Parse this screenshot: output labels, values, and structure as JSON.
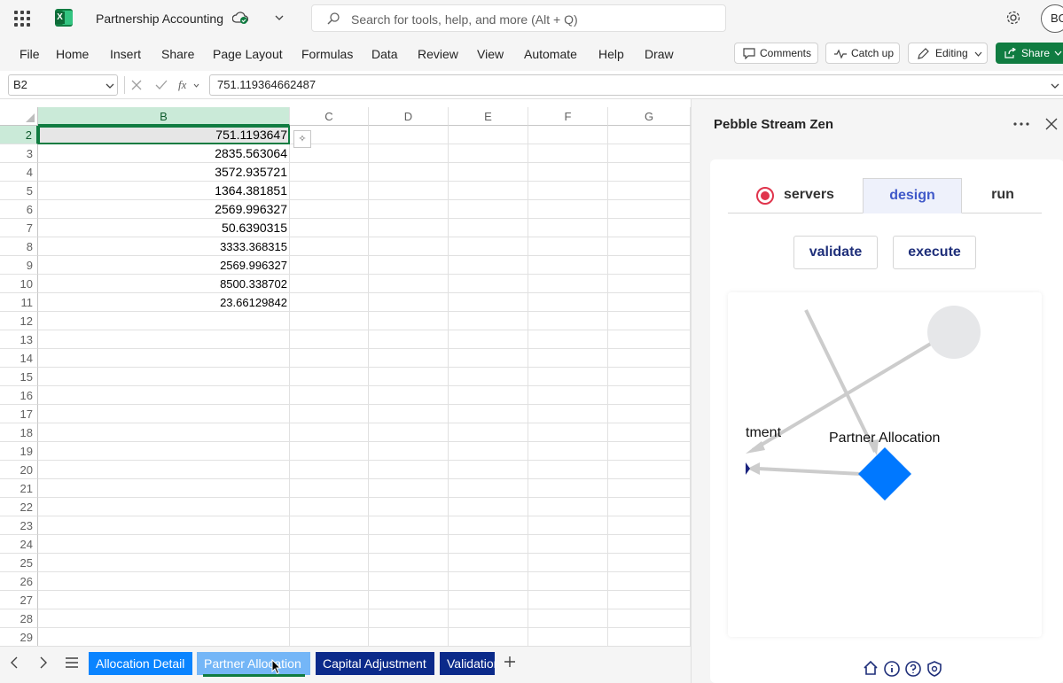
{
  "app": {
    "title": "Partnership Accounting",
    "search_placeholder": "Search for tools, help, and more (Alt + Q)",
    "user_initials": "BG",
    "brand_color": "#107c41"
  },
  "ribbon": {
    "menu": [
      "File",
      "Home",
      "Insert",
      "Share",
      "Page Layout",
      "Formulas",
      "Data",
      "Review",
      "View",
      "Automate",
      "Help",
      "Draw"
    ],
    "comments_label": "Comments",
    "catchup_label": "Catch up",
    "editing_label": "Editing",
    "share_label": "Share"
  },
  "formula_bar": {
    "name_box": "B2",
    "formula": "751.119364662487"
  },
  "grid": {
    "columns": [
      "B",
      "C",
      "D",
      "E",
      "F",
      "G"
    ],
    "selected_column": "B",
    "rows": [
      {
        "num": "2",
        "value": "751.1193647"
      },
      {
        "num": "3",
        "value": "2835.563064"
      },
      {
        "num": "4",
        "value": "3572.935721"
      },
      {
        "num": "5",
        "value": "1364.381851"
      },
      {
        "num": "6",
        "value": "2569.996327"
      },
      {
        "num": "7",
        "value": "50.6390315"
      },
      {
        "num": "8",
        "value": "3333.368315"
      },
      {
        "num": "9",
        "value": "2569.996327"
      },
      {
        "num": "10",
        "value": "8500.338702"
      },
      {
        "num": "11",
        "value": "23.66129842"
      },
      {
        "num": "12",
        "value": ""
      },
      {
        "num": "13",
        "value": ""
      },
      {
        "num": "14",
        "value": ""
      },
      {
        "num": "15",
        "value": ""
      },
      {
        "num": "16",
        "value": ""
      },
      {
        "num": "17",
        "value": ""
      },
      {
        "num": "18",
        "value": ""
      },
      {
        "num": "19",
        "value": ""
      },
      {
        "num": "20",
        "value": ""
      },
      {
        "num": "21",
        "value": ""
      },
      {
        "num": "22",
        "value": ""
      },
      {
        "num": "23",
        "value": ""
      },
      {
        "num": "24",
        "value": ""
      },
      {
        "num": "25",
        "value": ""
      },
      {
        "num": "26",
        "value": ""
      },
      {
        "num": "27",
        "value": ""
      },
      {
        "num": "28",
        "value": ""
      },
      {
        "num": "29",
        "value": ""
      }
    ]
  },
  "sheet_tabs": [
    {
      "label": "Allocation Detail",
      "color": "#0a84ff",
      "active": false
    },
    {
      "label": "Partner Allocation",
      "color": "#74b6f7",
      "active": true
    },
    {
      "label": "Capital Adjustment",
      "color": "#0b2a8a",
      "active": false
    },
    {
      "label": "Validation",
      "color": "#0b2a8a",
      "active": false
    }
  ],
  "pane": {
    "title": "Pebble Stream Zen",
    "tabs": {
      "servers": "servers",
      "design": "design",
      "run": "run"
    },
    "active_tab": "design",
    "validate_label": "validate",
    "execute_label": "execute",
    "diagram": {
      "node_partner_allocation": "Partner Allocation",
      "node_capital_adjustment_partial": "tment",
      "node_color": "#0078ff",
      "dark_node_color": "#1a237e",
      "edge_color": "#cccccc"
    }
  }
}
